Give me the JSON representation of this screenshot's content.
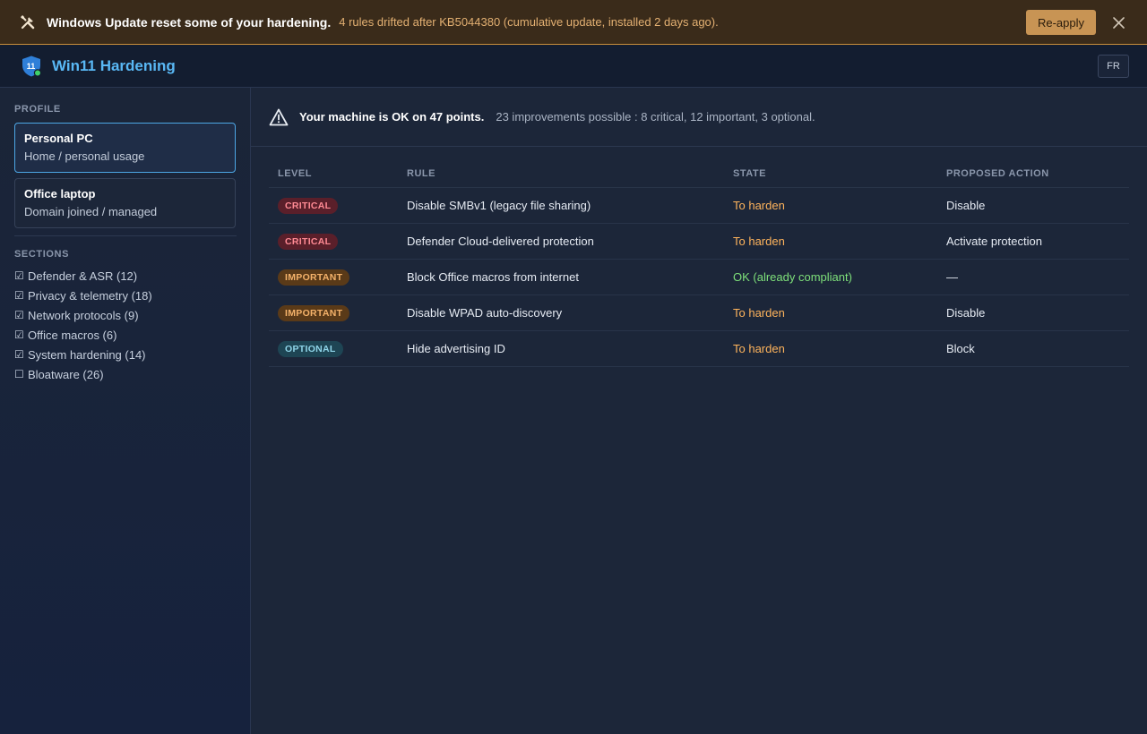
{
  "banner": {
    "icon": "tools-icon",
    "title": "Windows Update reset some of your hardening.",
    "detail": "4 rules drifted after KB5044380 (cumulative update, installed 2 days ago).",
    "reapply_label": "Re-apply",
    "close_icon": "close-icon",
    "accent_color": "#c89454"
  },
  "app": {
    "title": "Win11 Hardening",
    "logo_text": "11",
    "language": "FR"
  },
  "sidebar": {
    "profile_heading": "PROFILE",
    "profiles": [
      {
        "name": "Personal PC",
        "subtitle": "Home / personal usage",
        "active": true
      },
      {
        "name": "Office laptop",
        "subtitle": "Domain joined / managed",
        "active": false
      }
    ],
    "sections_heading": "SECTIONS",
    "sections": [
      {
        "label": "Defender & ASR (12)",
        "checked": true,
        "mark": "☑"
      },
      {
        "label": "Privacy & telemetry (18)",
        "checked": true,
        "mark": "☑"
      },
      {
        "label": "Network protocols (9)",
        "checked": true,
        "mark": "☑"
      },
      {
        "label": "Office macros (6)",
        "checked": true,
        "mark": "☑"
      },
      {
        "label": "System hardening (14)",
        "checked": true,
        "mark": "☑"
      },
      {
        "label": "Bloatware (26)",
        "checked": false,
        "mark": "☐"
      }
    ]
  },
  "summary": {
    "icon": "warning-icon",
    "main": "Your machine is OK on 47 points.",
    "detail": "23 improvements possible : 8 critical, 12 important, 3 optional."
  },
  "table": {
    "headers": [
      "LEVEL",
      "RULE",
      "STATE",
      "PROPOSED ACTION"
    ],
    "rows": [
      {
        "level": "CRITICAL",
        "rule": "Disable SMBv1 (legacy file sharing)",
        "state": "To harden",
        "action": "Disable"
      },
      {
        "level": "CRITICAL",
        "rule": "Defender Cloud-delivered protection",
        "state": "To harden",
        "action": "Activate protection"
      },
      {
        "level": "IMPORTANT",
        "rule": "Block Office macros from internet",
        "state": "OK (already compliant)",
        "action": "—"
      },
      {
        "level": "IMPORTANT",
        "rule": "Disable WPAD auto-discovery",
        "state": "To harden",
        "action": "Disable"
      },
      {
        "level": "OPTIONAL",
        "rule": "Hide advertising ID",
        "state": "To harden",
        "action": "Block"
      }
    ]
  }
}
